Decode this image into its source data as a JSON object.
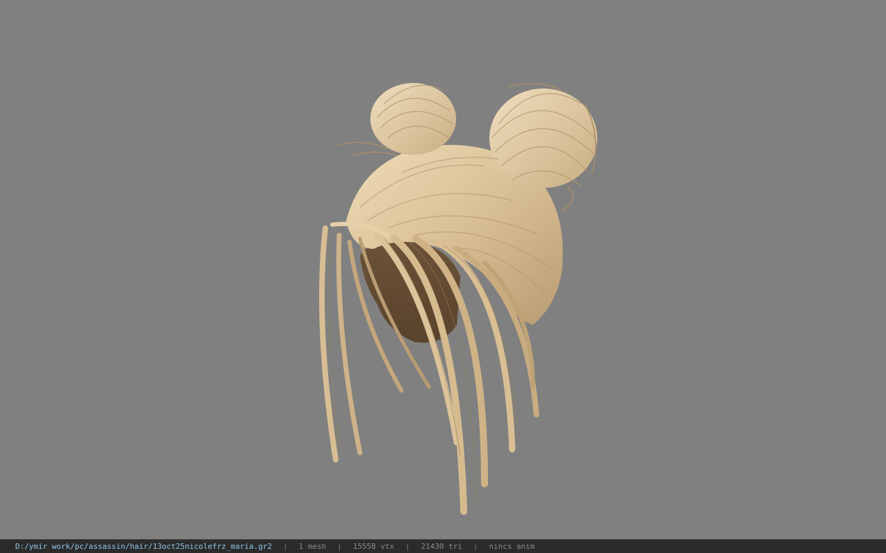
{
  "viewport": {
    "background": "#808080",
    "model_name": "hair mesh"
  },
  "status": {
    "file_path": "D:/ymir work/pc/assassin/hair/13oct25nicolefrz_maria.gr2",
    "separator": "|",
    "mesh_count": "1 mesh",
    "vertex_count": "15558 vtx",
    "triangle_count": "21430 tri",
    "anim_status": "nincs anim"
  },
  "colors": {
    "hair_light": "#e8d3ad",
    "hair_mid": "#cdb28a",
    "hair_dark": "#8a7050",
    "status_bar_bg": "#2b2b2b",
    "path_text": "#8fc6e8"
  }
}
